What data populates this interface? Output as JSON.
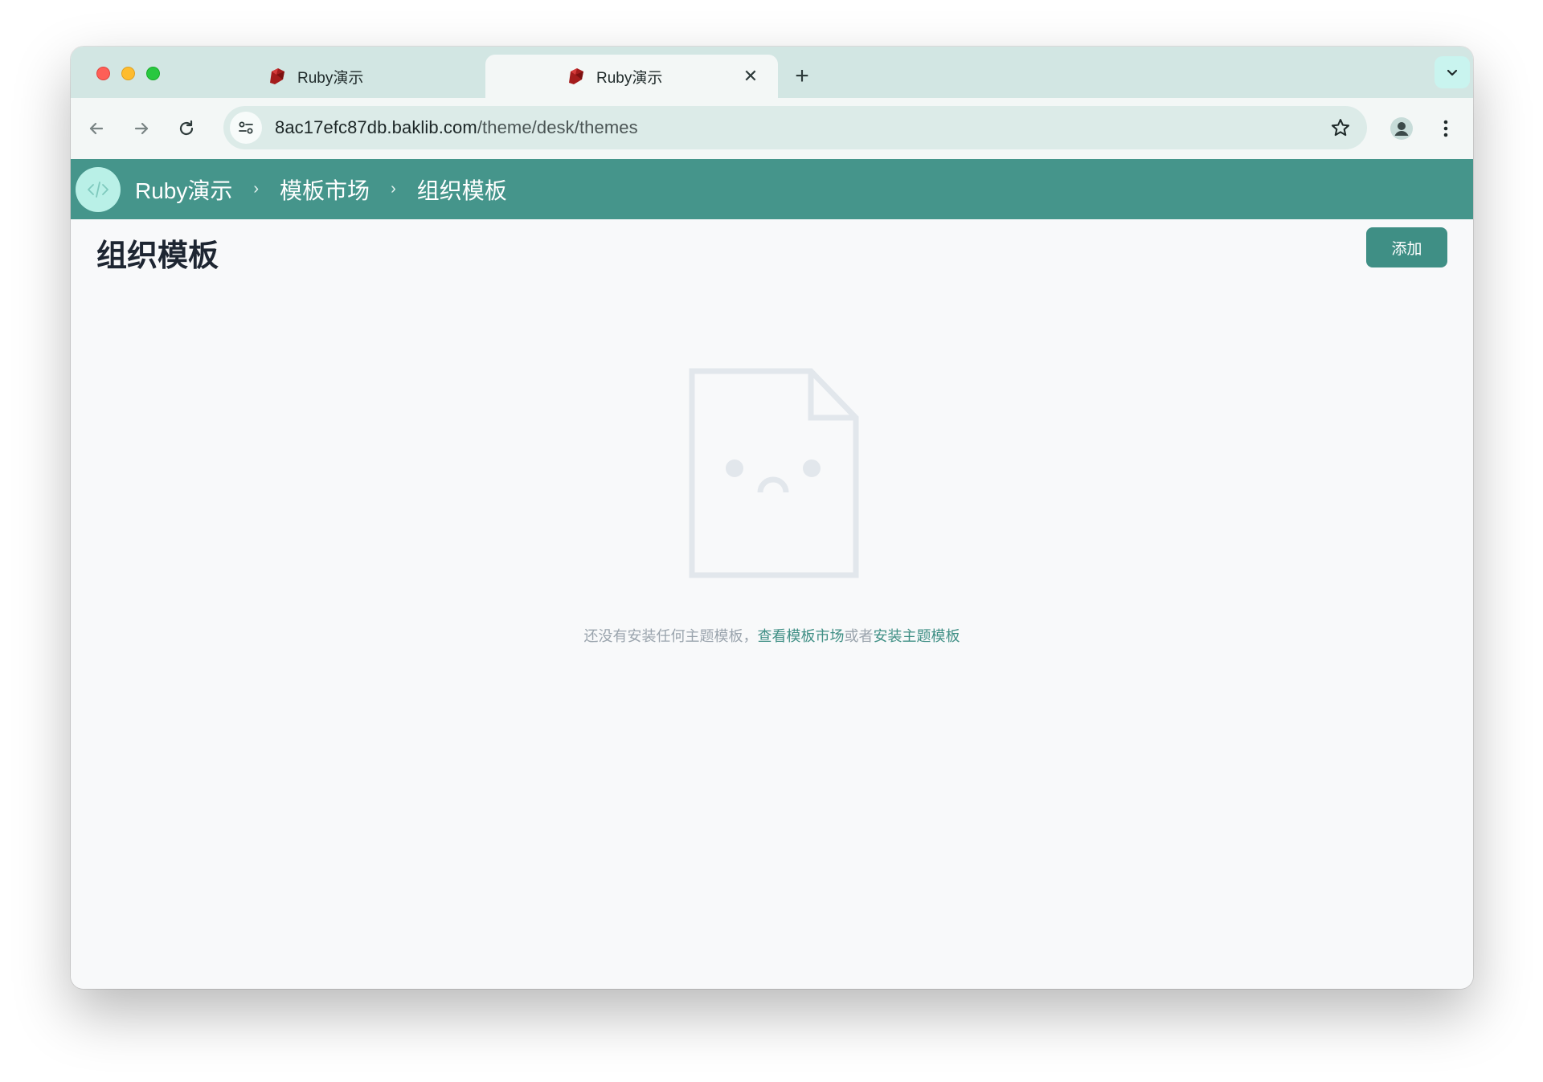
{
  "browser": {
    "tabs": [
      {
        "title": "Ruby演示",
        "active": false
      },
      {
        "title": "Ruby演示",
        "active": true
      }
    ],
    "close_glyph": "✕",
    "new_tab_glyph": "+",
    "url_host": "8ac17efc87db.baklib.com",
    "url_path": "/theme/desk/themes"
  },
  "appbar": {
    "breadcrumbs": [
      "Ruby演示",
      "模板市场",
      "组织模板"
    ],
    "separator": "›"
  },
  "page": {
    "title": "组织模板",
    "add_label": "添加"
  },
  "empty_state": {
    "message": "还没有安装任何主题模板，",
    "link_market": "查看模板市场",
    "or_text": "或者",
    "link_install": "安装主题模板"
  },
  "colors": {
    "accent": "#45958b",
    "button": "#3f8f85",
    "tabstrip": "#d2e6e3"
  }
}
